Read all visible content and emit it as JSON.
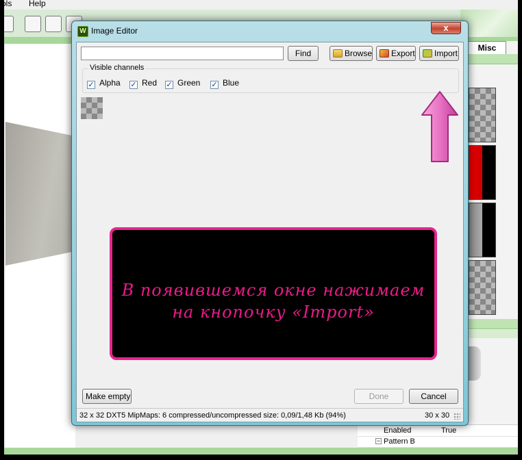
{
  "background": {
    "menu": [
      "ols",
      "Help"
    ],
    "tab_misc": "Misc",
    "properties": [
      {
        "name": "Enabled",
        "value": "True"
      },
      {
        "name": "Pattern B",
        "value": ""
      }
    ]
  },
  "dialog": {
    "title": "Image Editor",
    "close_glyph": "x",
    "path_value": "",
    "find_label": "Find",
    "browse_label": "Browse",
    "export_label": "Export",
    "import_label": "Import",
    "channels_label": "Visible channels",
    "channels": [
      {
        "label": "Alpha",
        "checked": true
      },
      {
        "label": "Red",
        "checked": true
      },
      {
        "label": "Green",
        "checked": true
      },
      {
        "label": "Blue",
        "checked": true
      }
    ],
    "check_glyph": "✓",
    "tutorial_text": "В появившемся окне нажимаем на кнопочку «Import»",
    "make_empty_label": "Make empty",
    "done_label": "Done",
    "cancel_label": "Cancel",
    "status_text": "32 x 32 DXT5 MipMaps: 6 compressed/uncompressed size: 0,09/1,48 Kb (94%)",
    "status_size": "30 x 30"
  },
  "colors": {
    "accent_pink": "#e8248c",
    "toolbar_green": "#a8d79a"
  }
}
